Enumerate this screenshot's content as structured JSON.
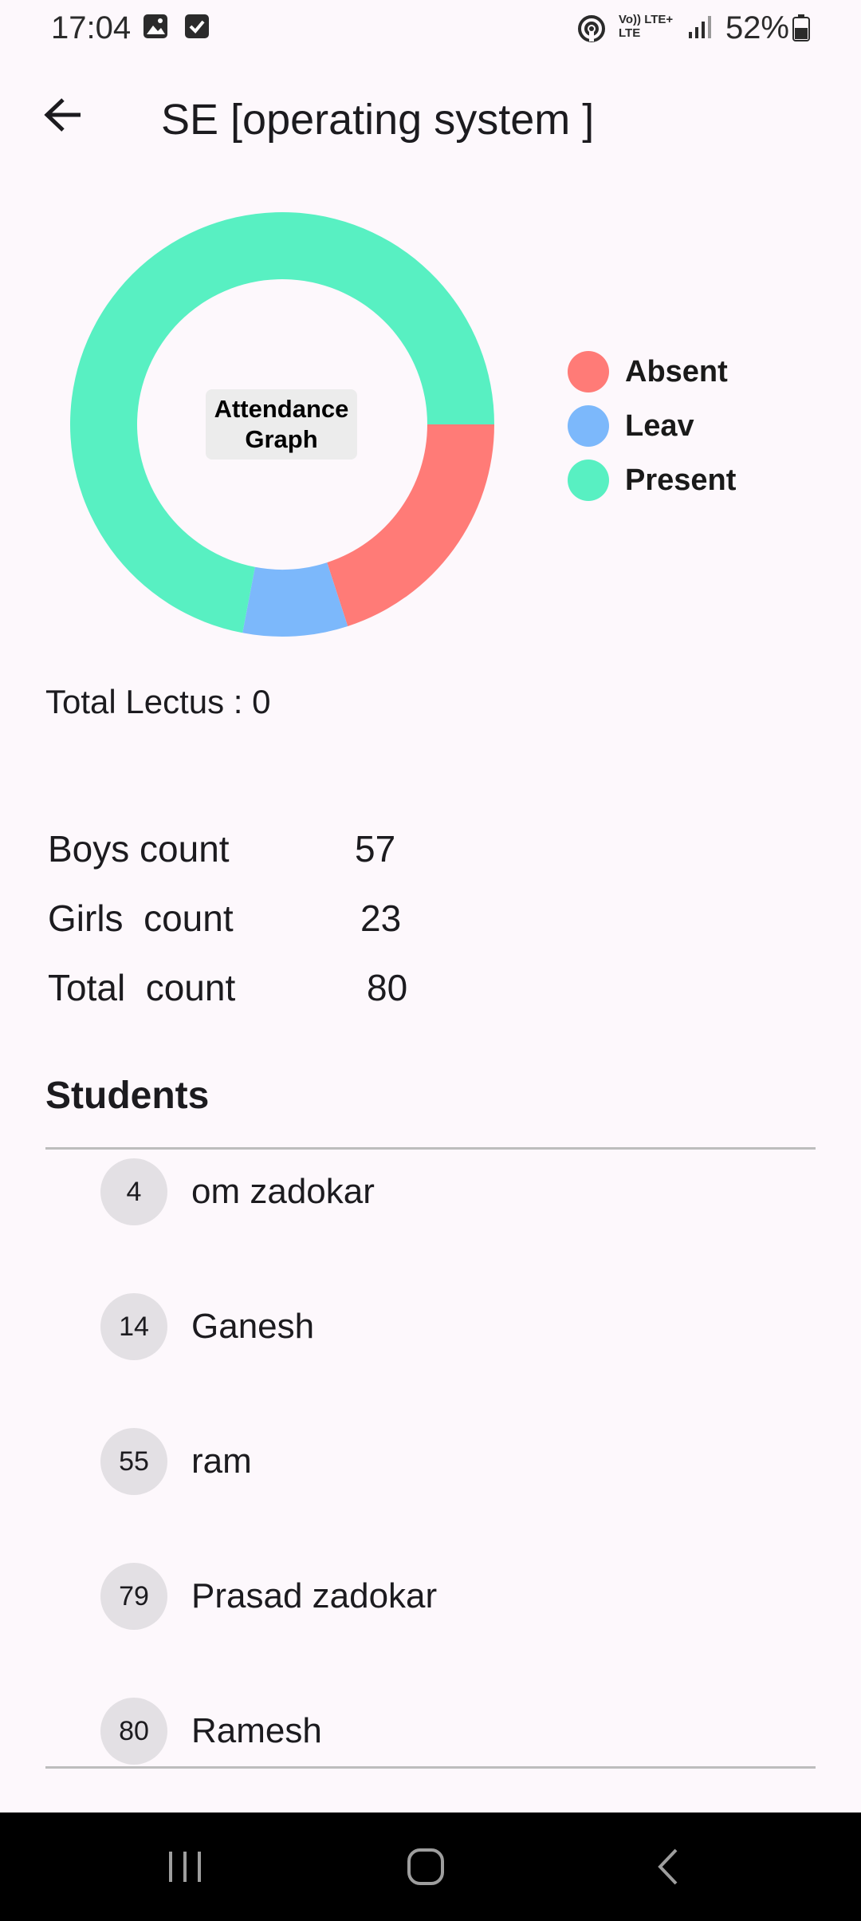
{
  "status_bar": {
    "time": "17:04",
    "battery_text": "52%",
    "net_label_top": "Vo)) LTE+",
    "net_label_bottom": "LTE"
  },
  "app_bar": {
    "title": "SE [operating system ]",
    "back_icon": "arrow-left-icon"
  },
  "chart_data": {
    "type": "pie",
    "title": "Attendance Graph",
    "categories": [
      "Absent",
      "Leav",
      "Present"
    ],
    "values": [
      20,
      8,
      72
    ],
    "colors": [
      "#ff7b77",
      "#7cb8fb",
      "#58f0c2"
    ],
    "legend_position": "right",
    "donut": true
  },
  "summary": {
    "total_lectures": "Total Lectus : 0",
    "counts": [
      {
        "label": "Boys count",
        "value": "57"
      },
      {
        "label": "Girls  count",
        "value": "23"
      },
      {
        "label": "Total  count",
        "value": "80"
      }
    ]
  },
  "students": {
    "heading": "Students",
    "items": [
      {
        "roll": "4",
        "name": "om zadokar"
      },
      {
        "roll": "14",
        "name": "Ganesh"
      },
      {
        "roll": "55",
        "name": "ram"
      },
      {
        "roll": "79",
        "name": "Prasad zadokar"
      },
      {
        "roll": "80",
        "name": "Ramesh"
      }
    ]
  },
  "nav_bar": {
    "recents_icon": "recents-icon",
    "home_icon": "home-icon",
    "back_icon": "back-chevron-icon"
  }
}
